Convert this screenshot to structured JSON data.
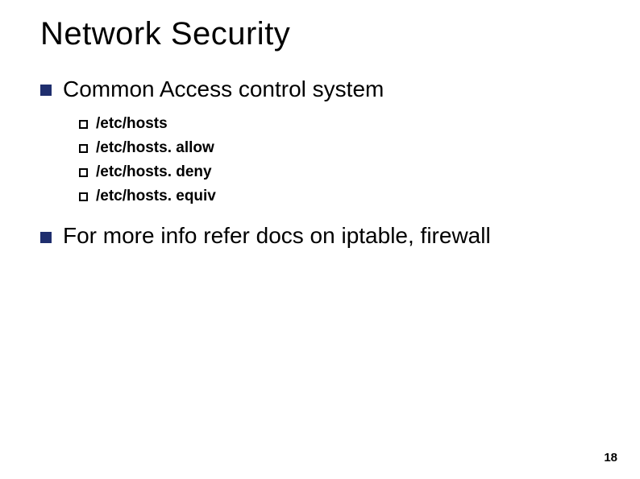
{
  "slide": {
    "title": "Network Security",
    "bullets": [
      {
        "text": "Common Access control system",
        "subitems": [
          "/etc/hosts",
          "/etc/hosts. allow",
          "/etc/hosts. deny",
          "/etc/hosts. equiv"
        ]
      },
      {
        "text": "For more info refer docs on iptable, firewall",
        "subitems": []
      }
    ],
    "page_number": "18"
  }
}
